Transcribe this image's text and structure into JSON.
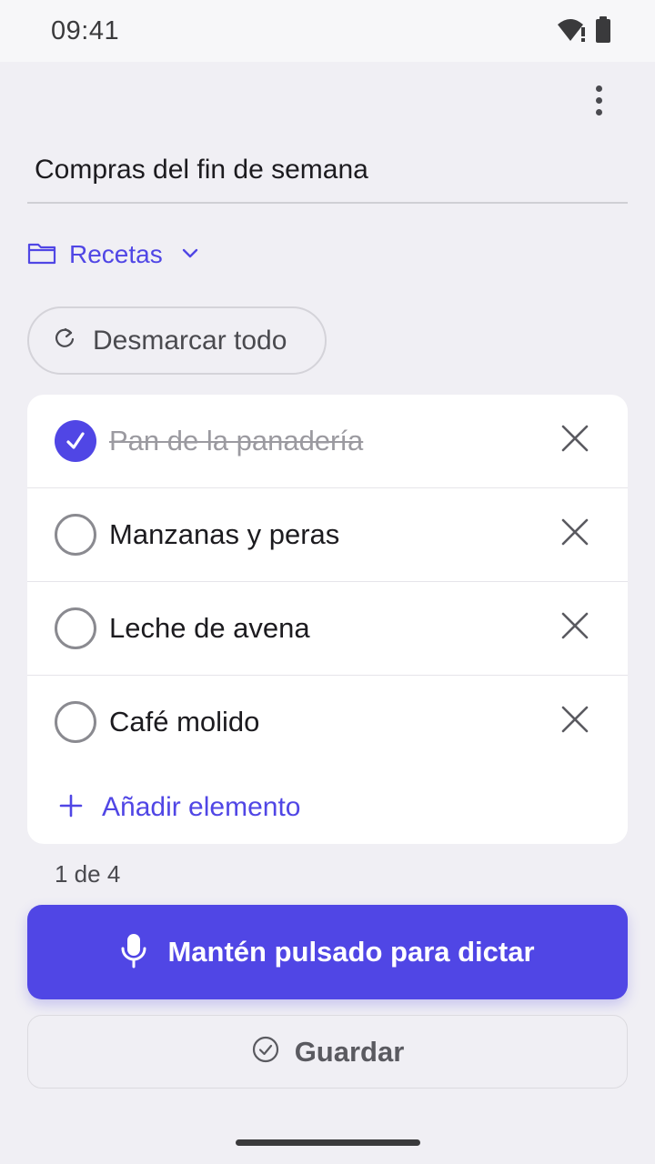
{
  "status_bar": {
    "time": "09:41",
    "wifi_icon": "wifi-alert-icon",
    "battery_icon": "battery-full-icon"
  },
  "header": {
    "menu_icon": "more-vert-icon"
  },
  "title_field": {
    "value": "Compras del fin de semana"
  },
  "folder": {
    "label": "Recetas",
    "icon": "folder-icon",
    "chevron": "chevron-down-icon"
  },
  "uncheck_all": {
    "label": "Desmarcar todo",
    "icon": "refresh-icon"
  },
  "items": [
    {
      "label": "Pan de la panadería",
      "checked": true
    },
    {
      "label": "Manzanas y peras",
      "checked": false
    },
    {
      "label": "Leche de avena",
      "checked": false
    },
    {
      "label": "Café molido",
      "checked": false
    }
  ],
  "add_item": {
    "label": "Añadir elemento",
    "icon": "plus-icon"
  },
  "progress": {
    "text": "1 de 4"
  },
  "dictate": {
    "label": "Mantén pulsado para dictar",
    "icon": "microphone-icon"
  },
  "save": {
    "label": "Guardar",
    "icon": "check-circle-icon"
  },
  "colors": {
    "accent": "#5046e5",
    "background": "#f0eff4",
    "card": "#ffffff"
  }
}
